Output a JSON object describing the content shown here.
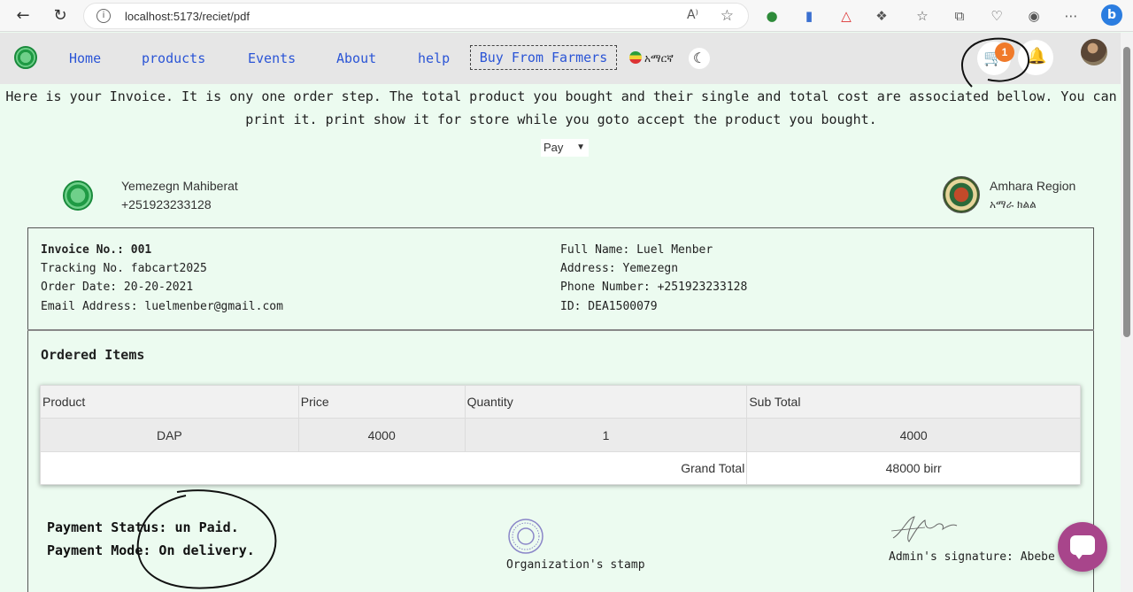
{
  "browser": {
    "url": "localhost:5173/reciet/pdf",
    "reader_label": "A⁾",
    "star_glyph": "☆"
  },
  "nav": {
    "links": [
      "Home",
      "products",
      "Events",
      "About",
      "help"
    ],
    "buy_button": "Buy From Farmers",
    "language": "አማርኛ",
    "cart_count": "1"
  },
  "intro_text": "Here is your Invoice. It is ony one order step. The total product you bought and their single and total cost are associated bellow. You can print it. print show it for store while you goto accept the product you bought.",
  "pay_select": {
    "selected": "Pay"
  },
  "organization": {
    "name": "Yemezegn Mahiberat",
    "phone": "+251923233128"
  },
  "region": {
    "name": "Amhara Region",
    "subtitle": "አማራ ክልል"
  },
  "invoice": {
    "invoice_no_label": "Invoice No.:",
    "invoice_no": "001",
    "tracking": "Tracking No. fabcart2025",
    "order_date": "Order Date: 20-20-2021",
    "email": "Email Address: luelmenber@gmail.com",
    "full_name": "Full Name: Luel Menber",
    "address": "Address: Yemezegn",
    "phone": "Phone Number: +251923233128",
    "id": "ID: DEA1500079"
  },
  "ordered_items": {
    "title": "Ordered Items",
    "headers": [
      "Product",
      "Price",
      "Quantity",
      "Sub Total"
    ],
    "rows": [
      {
        "product": "DAP",
        "price": "4000",
        "quantity": "1",
        "subtotal": "4000"
      }
    ],
    "grand_total_label": "Grand Total",
    "grand_total": "48000 birr"
  },
  "payment": {
    "status": "Payment Status: un Paid.",
    "mode": "Payment Mode: On delivery."
  },
  "stamp_label": "Organization's stamp",
  "signature_label": "Admin's signature: Abebe",
  "colors": {
    "link": "#2b55d6",
    "background": "#ecfbf0",
    "badge": "#f07a2a",
    "chat": "#a8458b"
  }
}
